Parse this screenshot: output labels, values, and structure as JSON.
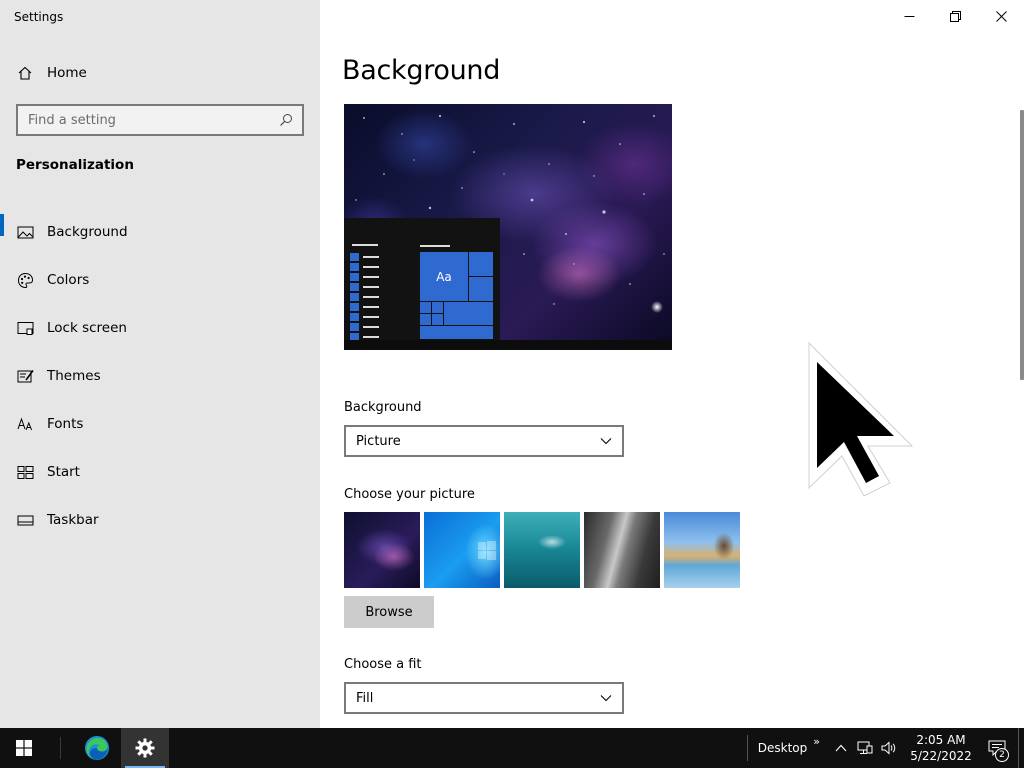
{
  "window": {
    "title": "Settings",
    "controls": [
      "minimize-icon",
      "restore-icon",
      "close-icon"
    ]
  },
  "sidebar": {
    "home_label": "Home",
    "search_placeholder": "Find a setting",
    "section_title": "Personalization",
    "items": [
      {
        "label": "Background",
        "icon": "picture-icon",
        "selected": true
      },
      {
        "label": "Colors",
        "icon": "palette-icon"
      },
      {
        "label": "Lock screen",
        "icon": "lock-screen-icon"
      },
      {
        "label": "Themes",
        "icon": "themes-brush-icon"
      },
      {
        "label": "Fonts",
        "icon": "fonts-icon"
      },
      {
        "label": "Start",
        "icon": "start-grid-icon"
      },
      {
        "label": "Taskbar",
        "icon": "taskbar-icon"
      }
    ]
  },
  "main": {
    "title": "Background",
    "preview_tile_text": "Aa",
    "background_label": "Background",
    "background_value": "Picture",
    "choose_picture_label": "Choose your picture",
    "browse_label": "Browse",
    "choose_fit_label": "Choose a fit",
    "fit_value": "Fill"
  },
  "taskbar": {
    "apps": [
      "windows-start-icon",
      "edge-icon",
      "settings-gear-icon"
    ],
    "desktop_label": "Desktop",
    "time": "2:05 AM",
    "date": "5/22/2022",
    "notification_count": "2",
    "tray_icons": [
      "chevron-up-icon",
      "network-icon",
      "volume-icon"
    ]
  },
  "colors": {
    "accent": "#0067c0",
    "sidebar_bg": "#e6e6e6",
    "taskbar_bg": "#101010"
  }
}
